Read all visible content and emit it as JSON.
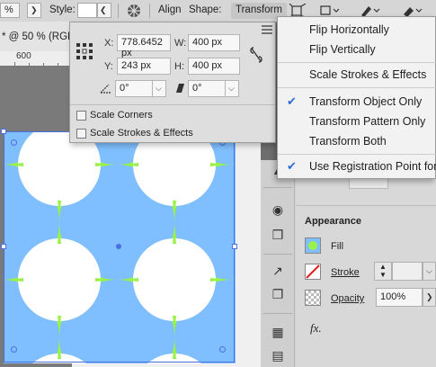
{
  "toolbar": {
    "zoom_field": "%",
    "style_label": "Style:",
    "align_label": "Align",
    "shape_label": "Shape:",
    "transform_label": "Transform"
  },
  "document": {
    "tab_title": "* @ 50 % (RGB",
    "ruler_number": "600"
  },
  "transform_panel": {
    "x_label": "X:",
    "x_value": "778.6452 px",
    "y_label": "Y:",
    "y_value": "243 px",
    "w_label": "W:",
    "w_value": "400 px",
    "h_label": "H:",
    "h_value": "400 px",
    "rotate_value": "0°",
    "shear_value": "0°",
    "scale_corners_label": "Scale Corners",
    "scale_strokes_label": "Scale Strokes & Effects"
  },
  "flyout_menu": {
    "items": [
      {
        "label": "Flip Horizontally",
        "checked": false
      },
      {
        "label": "Flip Vertically",
        "checked": false
      },
      {
        "label": "Scale Strokes & Effects",
        "checked": false
      },
      {
        "label": "Transform Object Only",
        "checked": true
      },
      {
        "label": "Transform Pattern Only",
        "checked": false
      },
      {
        "label": "Transform Both",
        "checked": false
      },
      {
        "label": "Use Registration Point for",
        "checked": true
      }
    ]
  },
  "properties": {
    "appearance_title": "Appearance",
    "fill_label": "Fill",
    "stroke_label": "Stroke",
    "opacity_label": "Opacity",
    "opacity_value": "100%",
    "fx_label": "fx."
  },
  "colors": {
    "pattern_blue": "#80bfff",
    "pattern_green": "#99f24a",
    "selection": "#4b6fe0",
    "menu_check": "#2b6bd8"
  }
}
